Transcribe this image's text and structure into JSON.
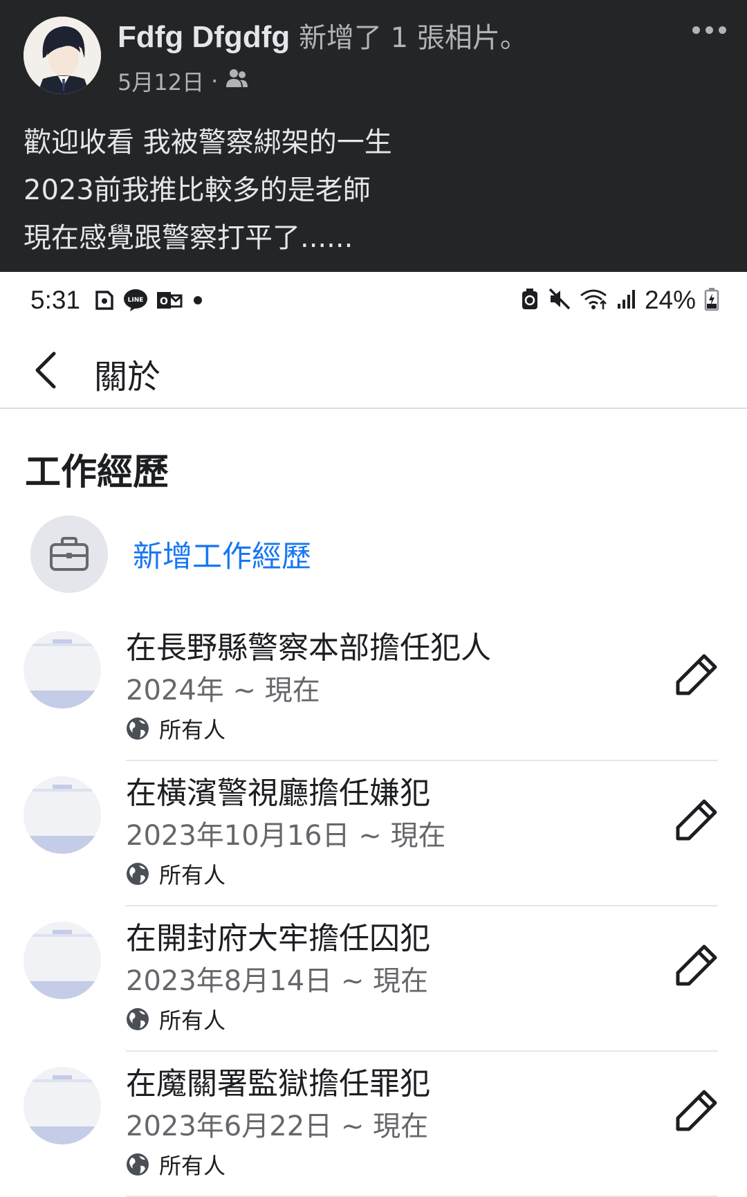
{
  "post": {
    "author": "Fdfg Dfgdfg",
    "action": "新增了 1 張相片。",
    "date": "5月12日",
    "separator": "·",
    "audience_icon": "friends-icon",
    "lines": [
      "歡迎收看 我被警察綁架的一生",
      "2023前我推比較多的是老師",
      "現在感覺跟警察打平了......"
    ]
  },
  "status_bar": {
    "time": "5:31",
    "battery": "24%",
    "left_icons": [
      "notification-icon",
      "line-icon",
      "outlook-icon",
      "dot-icon"
    ],
    "right_icons": [
      "alarm-icon",
      "mute-icon",
      "wifi-icon",
      "signal-icon",
      "battery-icon"
    ]
  },
  "appbar": {
    "title": "關於"
  },
  "section": {
    "title": "工作經歷",
    "add_label": "新增工作經歷",
    "entries": [
      {
        "title": "在長野縣警察本部擔任犯人",
        "dates": "2024年 ~ 現在",
        "audience": "所有人"
      },
      {
        "title": "在橫濱警視廳擔任嫌犯",
        "dates": "2023年10月16日 ~ 現在",
        "audience": "所有人"
      },
      {
        "title": "在開封府大牢擔任囚犯",
        "dates": "2023年8月14日 ~ 現在",
        "audience": "所有人"
      },
      {
        "title": "在魔關署監獄擔任罪犯",
        "dates": "2023年6月22日 ~ 現在",
        "audience": "所有人"
      }
    ]
  },
  "colors": {
    "link_blue": "#1877f2",
    "dark_card": "#242526",
    "thumb_blue": "#c5cce8"
  }
}
